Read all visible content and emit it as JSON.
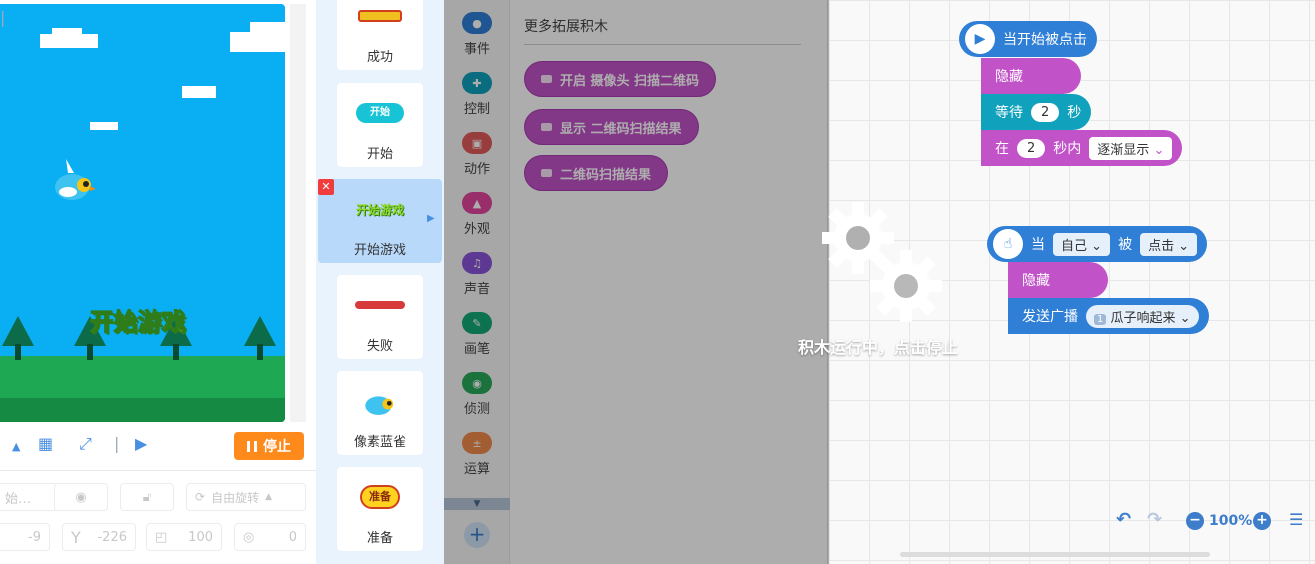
{
  "stage": {
    "title_text": "开始游戏",
    "stop_label": "停止",
    "props": {
      "name_value": "始…",
      "rotation_label": "自由旋转",
      "x_value": "-9",
      "y_label": "Y",
      "y_value": "-226",
      "size_value": "100",
      "direction_value": "0"
    }
  },
  "sprites": [
    {
      "name": "成功"
    },
    {
      "name": "开始",
      "thumb_text": "开始"
    },
    {
      "name": "开始游戏",
      "thumb_text": "开始游戏"
    },
    {
      "name": "失败"
    },
    {
      "name": "像素蓝雀"
    },
    {
      "name": "准备",
      "thumb_text": "准备"
    }
  ],
  "categories": [
    {
      "label": "事件",
      "color": "#2f7fd6"
    },
    {
      "label": "控制",
      "color": "#10a1bc"
    },
    {
      "label": "动作",
      "color": "#e05a5a"
    },
    {
      "label": "外观",
      "color": "#e0449d"
    },
    {
      "label": "声音",
      "color": "#8b55d9"
    },
    {
      "label": "画笔",
      "color": "#14a876"
    },
    {
      "label": "侦测",
      "color": "#29a85a"
    },
    {
      "label": "运算",
      "color": "#f08a4b"
    }
  ],
  "palette": {
    "title": "更多拓展积木",
    "blocks": [
      "开启 摄像头 扫描二维码",
      "显示 二维码扫描结果",
      "二维码扫描结果"
    ]
  },
  "script1": {
    "hat": "当开始被点击",
    "hide": "隐藏",
    "wait_label": "等待",
    "wait_value": "2",
    "wait_unit": "秒",
    "in_label": "在",
    "in_value": "2",
    "in_unit": "秒内",
    "effect": "逐渐显示"
  },
  "script2": {
    "when_label": "当",
    "target": "自己",
    "by_label": "被",
    "action": "点击",
    "hide": "隐藏",
    "broadcast_label": "发送广播",
    "message_badge": "1",
    "message": "瓜子响起来"
  },
  "overlay": {
    "hint": "积木运行中，点击停止"
  },
  "zoom": {
    "level": "100%"
  }
}
